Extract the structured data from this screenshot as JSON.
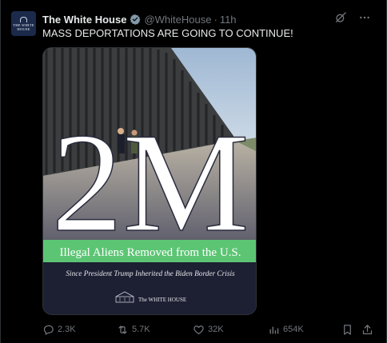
{
  "tweet": {
    "author": {
      "name": "The White House",
      "handle": "@WhiteHouse",
      "avatar_text": "THE WHITE HOUSE",
      "verified_color": "#829aab"
    },
    "time": "11h",
    "separator": "·",
    "text": "MASS DEPORTATIONS ARE GOING TO CONTINUE!",
    "media": {
      "headline_number": "2M",
      "banner_text": "Illegal Aliens Removed from the U.S.",
      "subtitle": "Since President Trump Inherited the Biden Border Crisis",
      "footer_logo_text": "The WHITE HOUSE",
      "banner_color": "#5cc574",
      "icons": [
        "border-wall-photo",
        "seal-icon"
      ]
    },
    "metrics": {
      "replies": "2.3K",
      "reposts": "5.7K",
      "likes": "32K",
      "views": "654K"
    },
    "icons": [
      "grok-icon",
      "more-icon",
      "reply-icon",
      "repost-icon",
      "like-icon",
      "views-icon",
      "bookmark-icon",
      "share-icon"
    ]
  }
}
